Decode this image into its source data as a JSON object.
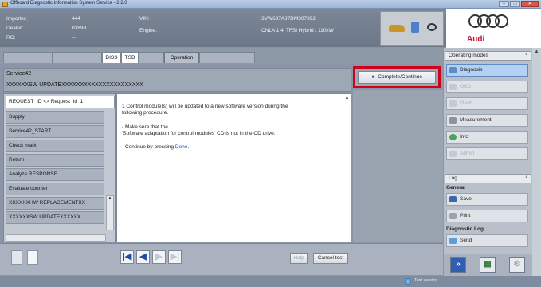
{
  "window": {
    "title": "Offboard Diagnostic Information System Service - 2.2.0",
    "controls": [
      "–",
      "□",
      "✕"
    ]
  },
  "header": {
    "importer_label": "Importer:",
    "importer_value": "444",
    "dealer_label": "Dealer:",
    "dealer_value": "03899",
    "ro_label": "RO:",
    "ro_value": "---",
    "vin_label": "VIN:",
    "vin_value": "3VW637AJ7DM307392",
    "engine_label": "Engine:",
    "engine_value": "CNLA 1.4l TFSI Hybrid / 110kW"
  },
  "logo": {
    "brand": "Audi"
  },
  "tabs": [
    "DISS",
    "TSB",
    "Operation"
  ],
  "service": {
    "name": "Service42",
    "title": "XXXXXXSW UPDATEXXXXXXXXXXXXXXXXXXXXXX"
  },
  "complete_button": "Complete/Continue",
  "steps": [
    "REQUEST_ID <> Request_Id_1",
    "Supply",
    "Service42_START",
    "Check mark",
    "Return",
    "Analyze RESPONSE",
    "Evaluate counter",
    "XXXXXXHW REPLACEMENTXX",
    "XXXXXXSW UPDATEXXXXXX"
  ],
  "instructions": {
    "line1": "1  Control module(s) will be updated to a new software version during the",
    "line2": "following procedure.",
    "line3": "- Make sure that the",
    "line4": "'Software adaptation for control modules' CD is not in the CD drive.",
    "line5_prefix": "- Continue by pressing ",
    "line5_link": "Done",
    "line5_suffix": "."
  },
  "bottom": {
    "nav_first": "|◀",
    "nav_prev": "◀",
    "nav_next": "▶",
    "nav_last": "▶|",
    "help": "Help",
    "cancel": "Cancel test"
  },
  "operating_modes": {
    "header": "Operating modes",
    "items": [
      {
        "label": "Diagnosis",
        "active": true
      },
      {
        "label": "OBD",
        "active": false
      },
      {
        "label": "Flash",
        "active": false
      },
      {
        "label": "Measurement",
        "active": false
      },
      {
        "label": "Info",
        "active": false
      },
      {
        "label": "Admin",
        "active": false
      }
    ]
  },
  "log": {
    "header": "Log",
    "general_label": "General",
    "save": "Save",
    "print": "Print",
    "diagnostic_log_label": "Diagnostic Log",
    "send": "Send"
  },
  "status": {
    "text": "Test version"
  },
  "colors": {
    "highlight_border": "#d0021b",
    "brand_red": "#c8102e"
  }
}
